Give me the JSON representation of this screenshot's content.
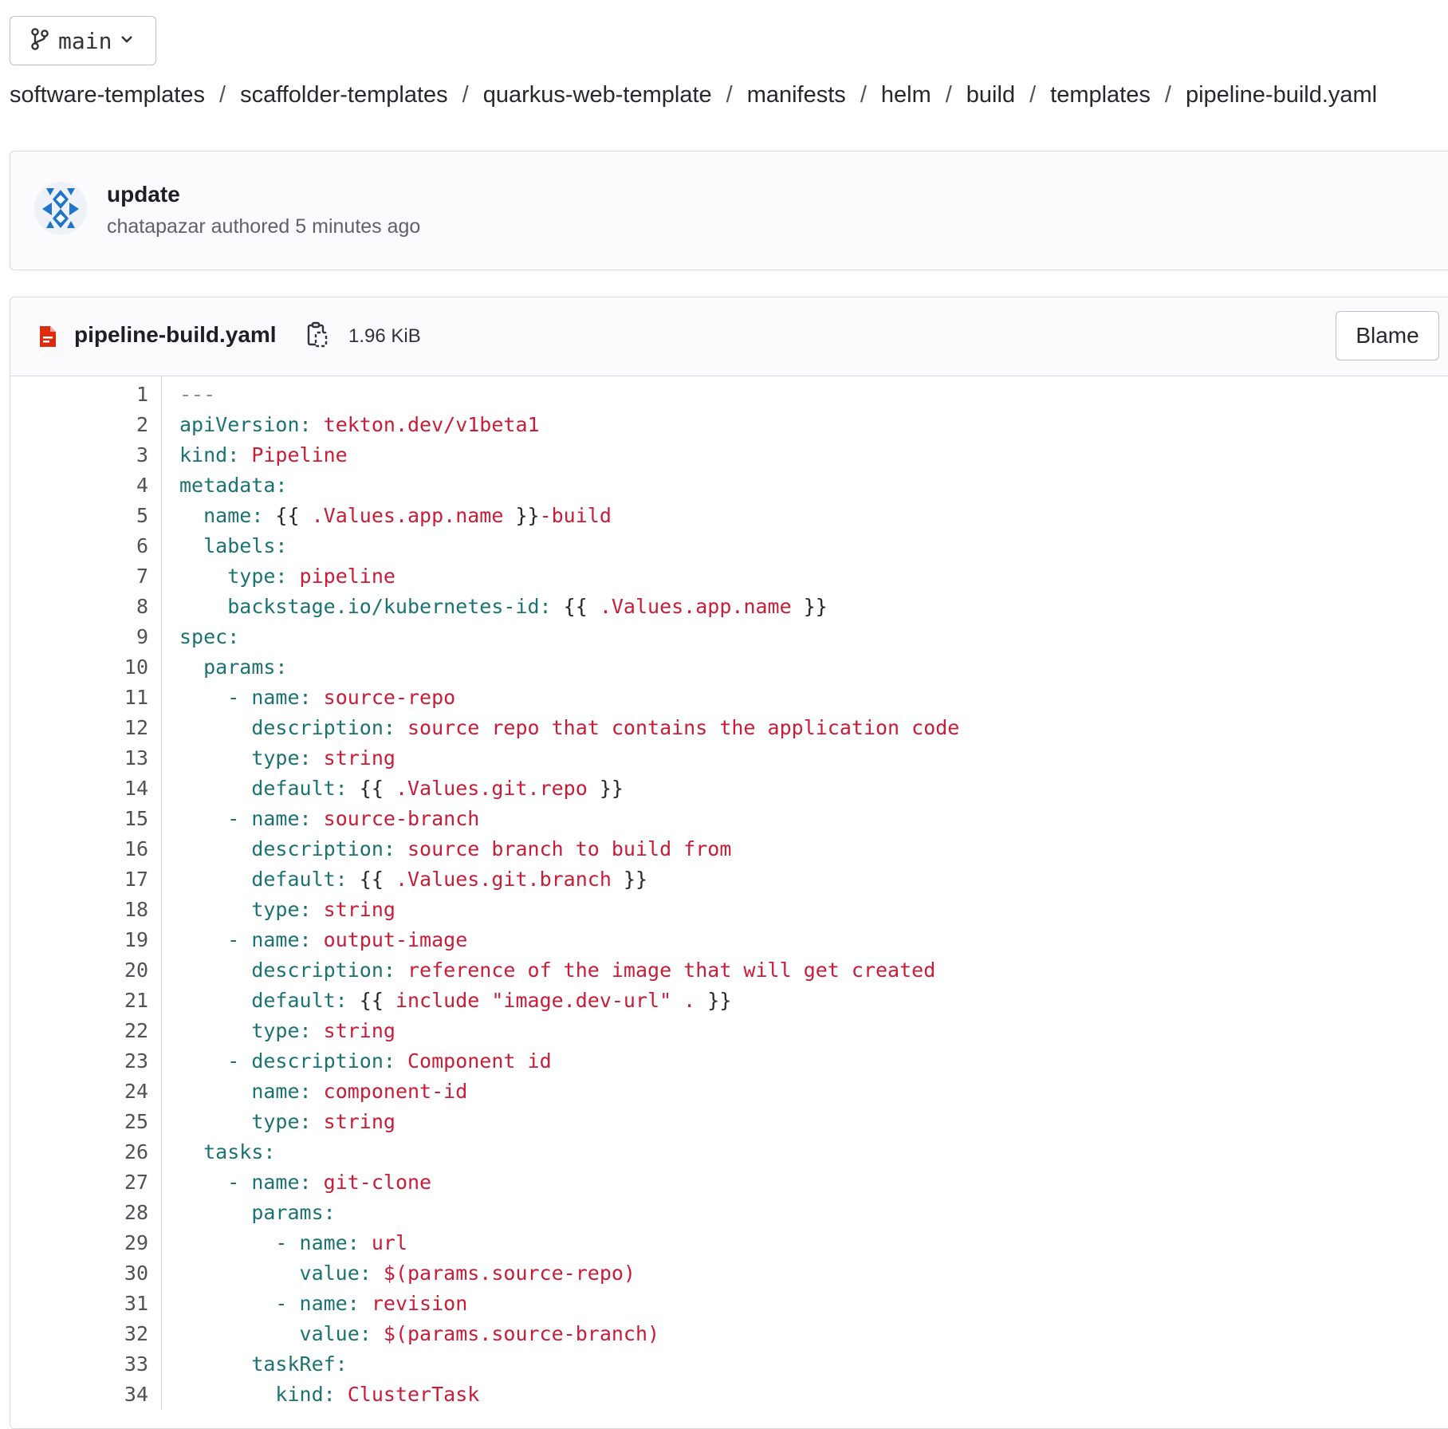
{
  "branch": {
    "name": "main"
  },
  "breadcrumb": [
    "software-templates",
    "scaffolder-templates",
    "quarkus-web-template",
    "manifests",
    "helm",
    "build",
    "templates",
    "pipeline-build.yaml"
  ],
  "breadcrumb_separator": "/",
  "commit": {
    "title": "update",
    "author": "chatapazar",
    "meta": "chatapazar authored 5 minutes ago"
  },
  "file": {
    "name": "pipeline-build.yaml",
    "size": "1.96 KiB",
    "blame_label": "Blame"
  },
  "colors": {
    "key": "#1a7370",
    "value": "#c91c37",
    "file_icon": "#dd2b0e",
    "avatar": "#1f75cb"
  },
  "code_lines": [
    [
      [
        "c",
        "---"
      ]
    ],
    [
      [
        "k",
        "apiVersion:"
      ],
      [
        "p",
        " "
      ],
      [
        "v",
        "tekton.dev/v1beta1"
      ]
    ],
    [
      [
        "k",
        "kind:"
      ],
      [
        "p",
        " "
      ],
      [
        "v",
        "Pipeline"
      ]
    ],
    [
      [
        "k",
        "metadata:"
      ]
    ],
    [
      [
        "p",
        "  "
      ],
      [
        "k",
        "name:"
      ],
      [
        "p",
        " {{ "
      ],
      [
        "v",
        ".Values.app.name"
      ],
      [
        "p",
        " }}"
      ],
      [
        "v",
        "-build"
      ]
    ],
    [
      [
        "p",
        "  "
      ],
      [
        "k",
        "labels:"
      ]
    ],
    [
      [
        "p",
        "    "
      ],
      [
        "k",
        "type:"
      ],
      [
        "p",
        " "
      ],
      [
        "v",
        "pipeline"
      ]
    ],
    [
      [
        "p",
        "    "
      ],
      [
        "k",
        "backstage.io/kubernetes-id:"
      ],
      [
        "p",
        " {{ "
      ],
      [
        "v",
        ".Values.app.name"
      ],
      [
        "p",
        " }}"
      ]
    ],
    [
      [
        "k",
        "spec:"
      ]
    ],
    [
      [
        "p",
        "  "
      ],
      [
        "k",
        "params:"
      ]
    ],
    [
      [
        "p",
        "    "
      ],
      [
        "k",
        "- name:"
      ],
      [
        "p",
        " "
      ],
      [
        "v",
        "source-repo"
      ]
    ],
    [
      [
        "p",
        "      "
      ],
      [
        "k",
        "description:"
      ],
      [
        "p",
        " "
      ],
      [
        "v",
        "source repo that contains the application code"
      ]
    ],
    [
      [
        "p",
        "      "
      ],
      [
        "k",
        "type:"
      ],
      [
        "p",
        " "
      ],
      [
        "v",
        "string"
      ]
    ],
    [
      [
        "p",
        "      "
      ],
      [
        "k",
        "default:"
      ],
      [
        "p",
        " {{ "
      ],
      [
        "v",
        ".Values.git.repo"
      ],
      [
        "p",
        " }}"
      ]
    ],
    [
      [
        "p",
        "    "
      ],
      [
        "k",
        "- name:"
      ],
      [
        "p",
        " "
      ],
      [
        "v",
        "source-branch"
      ]
    ],
    [
      [
        "p",
        "      "
      ],
      [
        "k",
        "description:"
      ],
      [
        "p",
        " "
      ],
      [
        "v",
        "source branch to build from"
      ]
    ],
    [
      [
        "p",
        "      "
      ],
      [
        "k",
        "default:"
      ],
      [
        "p",
        " {{ "
      ],
      [
        "v",
        ".Values.git.branch"
      ],
      [
        "p",
        " }}"
      ]
    ],
    [
      [
        "p",
        "      "
      ],
      [
        "k",
        "type:"
      ],
      [
        "p",
        " "
      ],
      [
        "v",
        "string"
      ]
    ],
    [
      [
        "p",
        "    "
      ],
      [
        "k",
        "- name:"
      ],
      [
        "p",
        " "
      ],
      [
        "v",
        "output-image"
      ]
    ],
    [
      [
        "p",
        "      "
      ],
      [
        "k",
        "description:"
      ],
      [
        "p",
        " "
      ],
      [
        "v",
        "reference of the image that will get created"
      ]
    ],
    [
      [
        "p",
        "      "
      ],
      [
        "k",
        "default:"
      ],
      [
        "p",
        " {{ "
      ],
      [
        "v",
        "include \"image.dev-url\" ."
      ],
      [
        "p",
        " }}"
      ]
    ],
    [
      [
        "p",
        "      "
      ],
      [
        "k",
        "type:"
      ],
      [
        "p",
        " "
      ],
      [
        "v",
        "string"
      ]
    ],
    [
      [
        "p",
        "    "
      ],
      [
        "k",
        "- description:"
      ],
      [
        "p",
        " "
      ],
      [
        "v",
        "Component id"
      ]
    ],
    [
      [
        "p",
        "      "
      ],
      [
        "k",
        "name:"
      ],
      [
        "p",
        " "
      ],
      [
        "v",
        "component-id"
      ]
    ],
    [
      [
        "p",
        "      "
      ],
      [
        "k",
        "type:"
      ],
      [
        "p",
        " "
      ],
      [
        "v",
        "string"
      ]
    ],
    [
      [
        "p",
        "  "
      ],
      [
        "k",
        "tasks:"
      ]
    ],
    [
      [
        "p",
        "    "
      ],
      [
        "k",
        "- name:"
      ],
      [
        "p",
        " "
      ],
      [
        "v",
        "git-clone"
      ]
    ],
    [
      [
        "p",
        "      "
      ],
      [
        "k",
        "params:"
      ]
    ],
    [
      [
        "p",
        "        "
      ],
      [
        "k",
        "- name:"
      ],
      [
        "p",
        " "
      ],
      [
        "v",
        "url"
      ]
    ],
    [
      [
        "p",
        "          "
      ],
      [
        "k",
        "value:"
      ],
      [
        "p",
        " "
      ],
      [
        "v",
        "$(params.source-repo)"
      ]
    ],
    [
      [
        "p",
        "        "
      ],
      [
        "k",
        "- name:"
      ],
      [
        "p",
        " "
      ],
      [
        "v",
        "revision"
      ]
    ],
    [
      [
        "p",
        "          "
      ],
      [
        "k",
        "value:"
      ],
      [
        "p",
        " "
      ],
      [
        "v",
        "$(params.source-branch)"
      ]
    ],
    [
      [
        "p",
        "      "
      ],
      [
        "k",
        "taskRef:"
      ]
    ],
    [
      [
        "p",
        "        "
      ],
      [
        "k",
        "kind:"
      ],
      [
        "p",
        " "
      ],
      [
        "v",
        "ClusterTask"
      ]
    ]
  ]
}
